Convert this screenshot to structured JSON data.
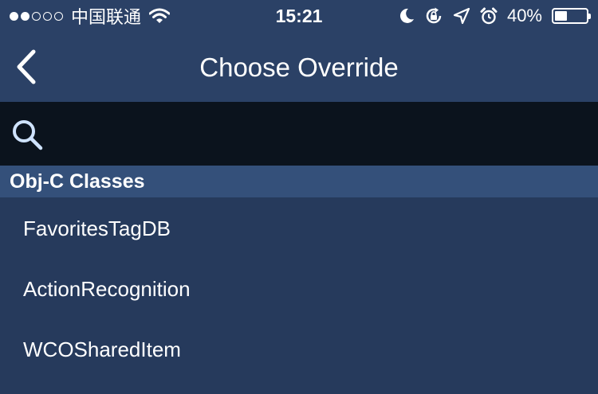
{
  "status_bar": {
    "signal_dots_filled": 2,
    "signal_dots_total": 5,
    "carrier": "中国联通",
    "time": "15:21",
    "battery_percent_text": "40%",
    "battery_level": 0.4,
    "icons": [
      "wifi-icon",
      "moon-icon",
      "rotation-lock-icon",
      "location-arrow-icon",
      "alarm-icon",
      "battery-icon"
    ]
  },
  "nav": {
    "title": "Choose Override",
    "back_icon": "chevron-left-icon"
  },
  "search": {
    "icon": "search-icon",
    "value": "",
    "placeholder": ""
  },
  "section": {
    "title": "Obj-C Classes"
  },
  "list": {
    "items": [
      {
        "label": "FavoritesTagDB"
      },
      {
        "label": "ActionRecognition"
      },
      {
        "label": "WCOSharedItem"
      }
    ]
  },
  "colors": {
    "nav_background": "#2b4166",
    "list_background": "#263a5c",
    "search_background": "#0b131d",
    "section_background": "#34507a",
    "search_icon": "#cfe3ff",
    "text": "#ffffff"
  }
}
